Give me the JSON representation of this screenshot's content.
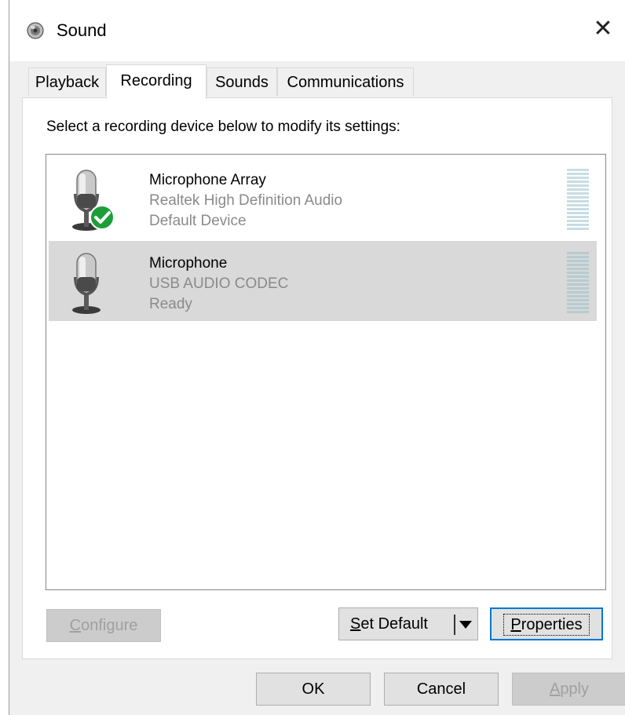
{
  "window": {
    "title": "Sound",
    "close_label": "✕"
  },
  "tabs": [
    {
      "label": "Playback",
      "active": false
    },
    {
      "label": "Recording",
      "active": true
    },
    {
      "label": "Sounds",
      "active": false
    },
    {
      "label": "Communications",
      "active": false
    }
  ],
  "panel": {
    "instruction": "Select a recording device below to modify its settings:"
  },
  "devices": [
    {
      "name": "Microphone Array",
      "driver": "Realtek High Definition Audio",
      "status": "Default Device",
      "is_default": true,
      "selected": false,
      "icon": "microphone-icon"
    },
    {
      "name": "Microphone",
      "driver": "USB AUDIO  CODEC",
      "status": "Ready",
      "is_default": false,
      "selected": true,
      "icon": "microphone-icon"
    }
  ],
  "buttons": {
    "configure": {
      "label_u": "C",
      "label_rest": "onfigure",
      "enabled": false
    },
    "set_default": {
      "label_u": "S",
      "label_rest": "et Default"
    },
    "properties": {
      "label_u": "P",
      "label_rest": "roperties"
    },
    "ok": "OK",
    "cancel": "Cancel",
    "apply": {
      "label_u": "A",
      "label_rest": "pply",
      "enabled": false
    }
  },
  "colors": {
    "accent": "#0078d7",
    "meter": "#c7dde3",
    "check": "#1e9e3a"
  }
}
